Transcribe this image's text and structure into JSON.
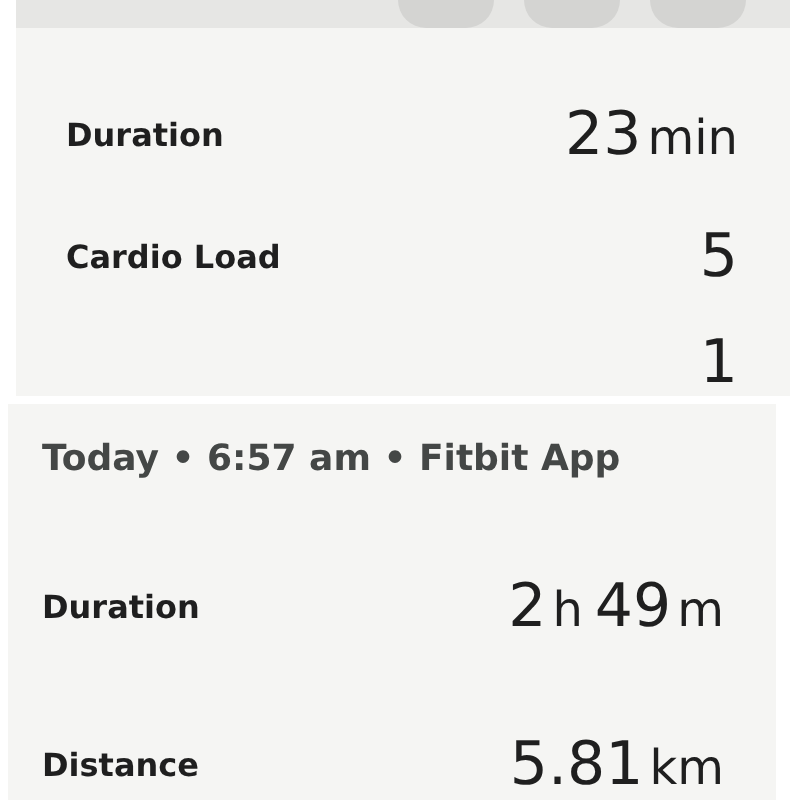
{
  "panels": [
    {
      "rows": [
        {
          "label": "Duration",
          "value": [
            {
              "kind": "number",
              "text": "23"
            },
            {
              "kind": "unit",
              "text": "min"
            }
          ]
        },
        {
          "label": "Cardio Load",
          "value": [
            {
              "kind": "number",
              "text": "5"
            }
          ]
        },
        {
          "value": [
            {
              "kind": "number",
              "text": "1"
            }
          ]
        }
      ]
    },
    {
      "header": "Today • 6:57 am • Fitbit App",
      "rows": [
        {
          "label": "Duration",
          "value": [
            {
              "kind": "number",
              "text": "2"
            },
            {
              "kind": "unit",
              "text": "h"
            },
            {
              "kind": "number",
              "text": "49"
            },
            {
              "kind": "unit",
              "text": "m"
            }
          ]
        },
        {
          "label": "Distance",
          "value": [
            {
              "kind": "number",
              "text": "5.81"
            },
            {
              "kind": "unit",
              "text": "km"
            }
          ]
        }
      ]
    }
  ]
}
